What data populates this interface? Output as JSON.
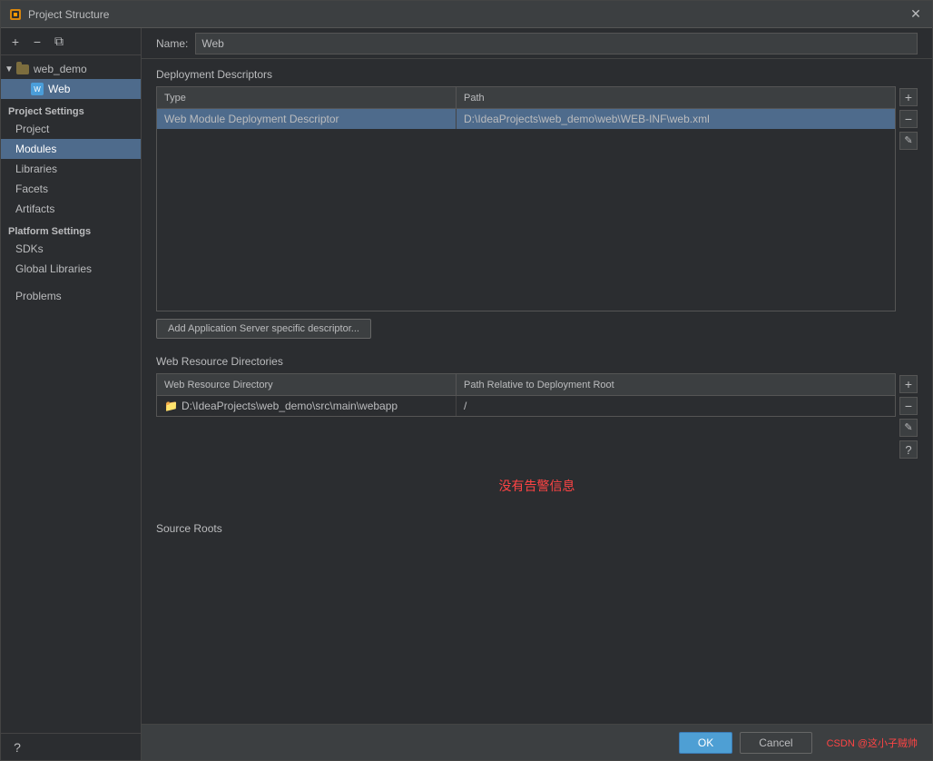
{
  "titleBar": {
    "icon": "🔧",
    "title": "Project Structure",
    "closeBtn": "✕"
  },
  "leftToolbar": {
    "addBtn": "+",
    "removeBtn": "−",
    "copyBtn": "⧉"
  },
  "tree": {
    "projectItem": "web_demo",
    "moduleItem": "Web"
  },
  "projectSettings": {
    "label": "Project Settings",
    "items": [
      "Project",
      "Modules",
      "Libraries",
      "Facets",
      "Artifacts"
    ]
  },
  "platformSettings": {
    "label": "Platform Settings",
    "items": [
      "SDKs",
      "Global Libraries"
    ]
  },
  "problems": {
    "label": "Problems"
  },
  "nameRow": {
    "label": "Name:",
    "value": "Web"
  },
  "deploymentDescriptors": {
    "sectionTitle": "Deployment Descriptors",
    "columns": {
      "type": "Type",
      "path": "Path"
    },
    "rows": [
      {
        "type": "Web Module Deployment Descriptor",
        "path": "D:\\IdeaProjects\\web_demo\\web\\WEB-INF\\web.xml"
      }
    ],
    "addBtn": "Add Application Server specific descriptor...",
    "sideBtns": {
      "plus": "+",
      "minus": "−",
      "edit": "✎"
    }
  },
  "webResourceDirectories": {
    "sectionTitle": "Web Resource Directories",
    "columns": {
      "dir": "Web Resource Directory",
      "relPath": "Path Relative to Deployment Root"
    },
    "rows": [
      {
        "dir": "D:\\IdeaProjects\\web_demo\\src\\main\\webapp",
        "relPath": "/"
      }
    ],
    "sideBtns": {
      "plus": "+",
      "minus": "−",
      "edit": "✎",
      "question": "?"
    }
  },
  "warningText": "没有告警信息",
  "sourceRootsLabel": "Source Roots",
  "bottomBar": {
    "okBtn": "OK",
    "cancelBtn": "Cancel",
    "watermark": "CSDN @这小子贼帅"
  },
  "helpBtn": "?",
  "colors": {
    "selectedBg": "#4e6b8c",
    "accent": "#4e9fd4"
  }
}
